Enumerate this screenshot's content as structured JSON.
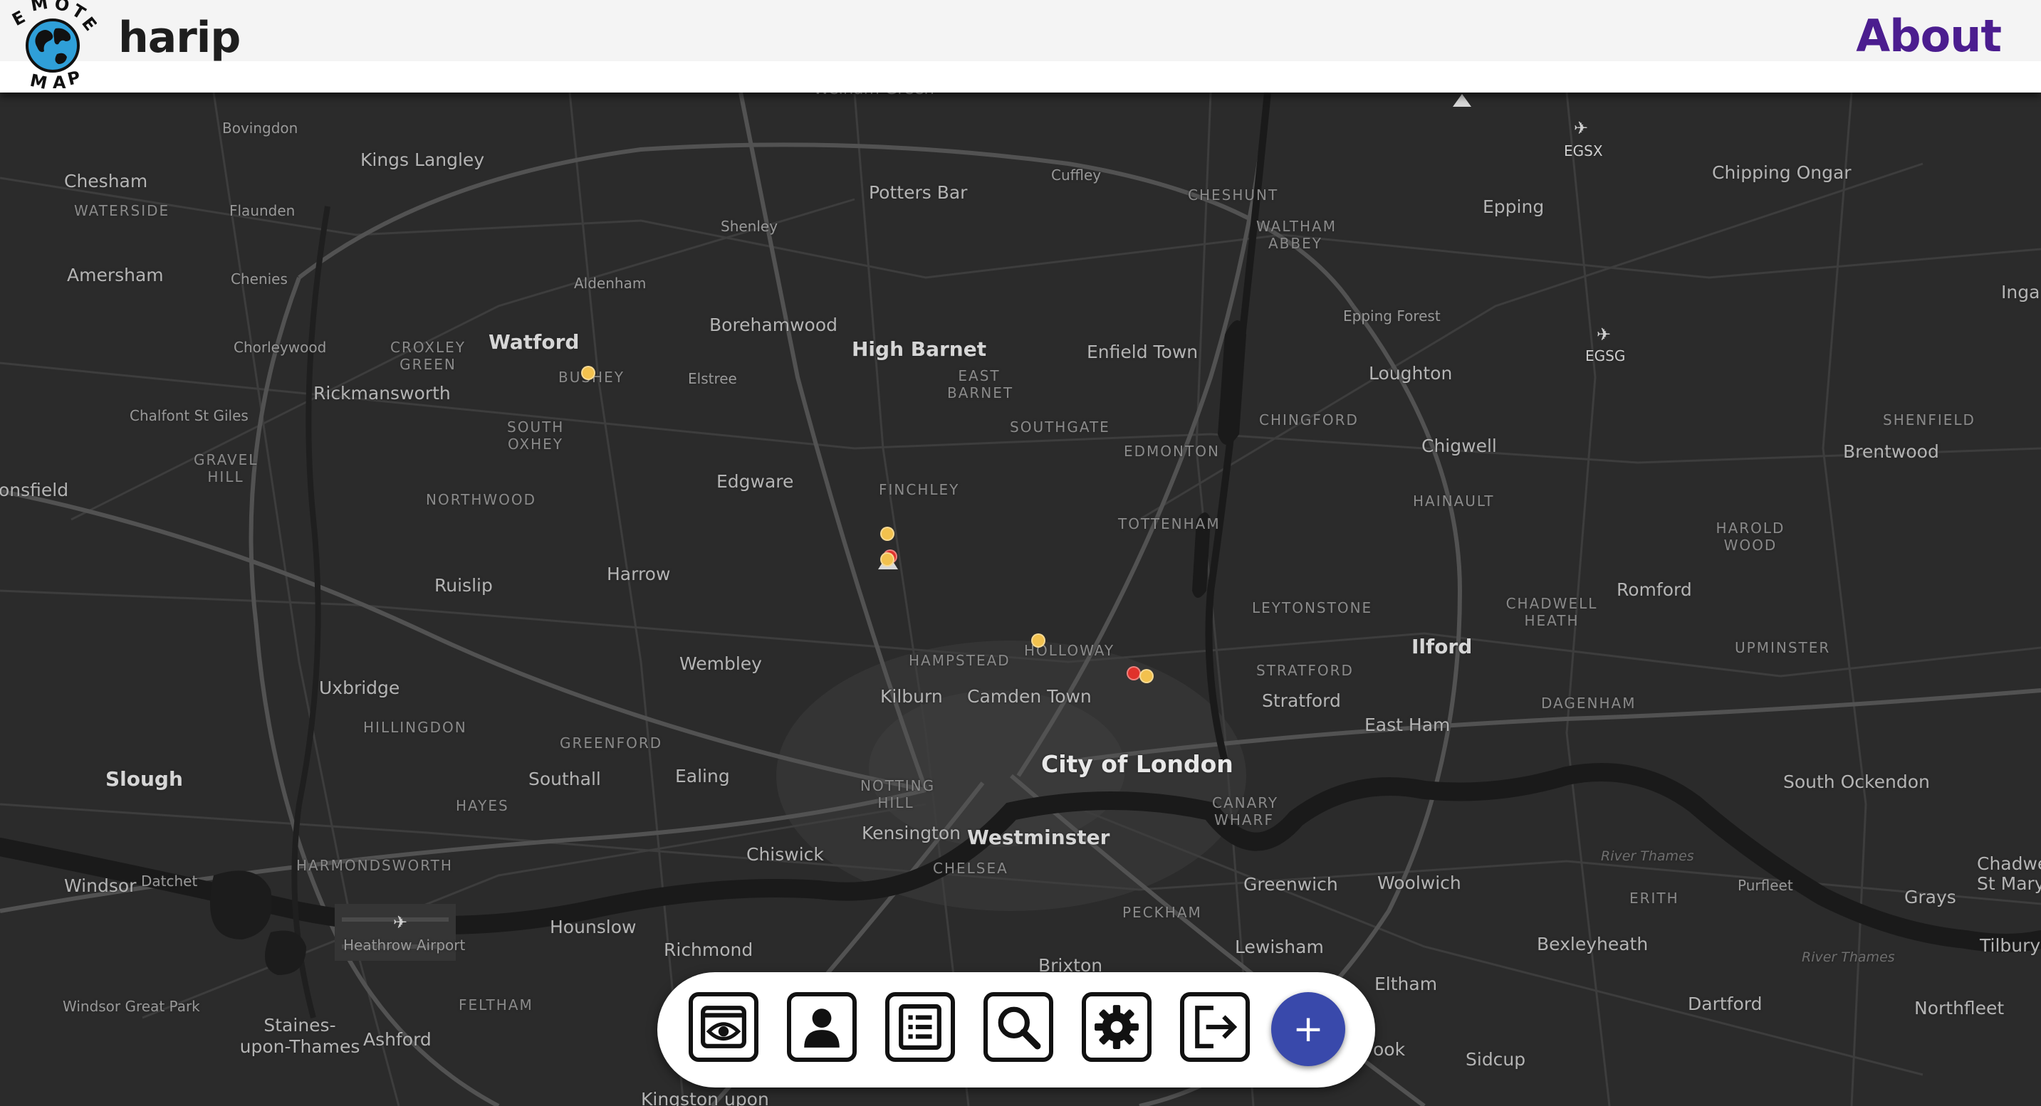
{
  "app": {
    "brand_name": "harip",
    "logo_text": "EMOTE MAP",
    "nav_about": "About"
  },
  "toolbar": {
    "buttons": [
      {
        "name": "view",
        "icon": "eye-icon"
      },
      {
        "name": "profile",
        "icon": "user-icon"
      },
      {
        "name": "list",
        "icon": "list-icon"
      },
      {
        "name": "search",
        "icon": "search-icon"
      },
      {
        "name": "settings",
        "icon": "gear-icon"
      },
      {
        "name": "logout",
        "icon": "logout-icon"
      }
    ],
    "add_label": "+",
    "add_color": "#3949ab"
  },
  "map": {
    "theme_color": "#2b2b2b",
    "labels": {
      "wenham_green": "Welham Green",
      "bovingdon": "Bovingdon",
      "kings_langley": "Kings Langley",
      "chesham": "Chesham",
      "waterside": "WATERSIDE",
      "flaunden": "Flaunden",
      "potters_bar": "Potters Bar",
      "cuffley": "Cuffley",
      "cheshunt": "CHESHUNT",
      "waltham_abbey": "WALTHAM ABBEY",
      "epping": "Epping",
      "chipping_ongar": "Chipping Ongar",
      "shenley": "Shenley",
      "amersham": "Amersham",
      "chenies": "Chenies",
      "aldenham": "Aldenham",
      "ingat": "Inga",
      "borehamwood": "Borehamwood",
      "epping_forest": "Epping Forest",
      "chorleywood": "Chorleywood",
      "croxley_green": "CROXLEY GREEN",
      "watford": "Watford",
      "high_barnet": "High Barnet",
      "enfield_town": "Enfield Town",
      "loughton": "Loughton",
      "bushey": "BUSHEY",
      "elstree": "Elstree",
      "east_barnet": "EAST BARNET",
      "rickmansworth": "Rickmansworth",
      "chalfont": "Chalfont St Giles",
      "south_oxhey": "SOUTH OXHEY",
      "southgate": "SOUTHGATE",
      "chingford": "CHINGFORD",
      "shenfield": "SHENFIELD",
      "chigwell": "Chigwell",
      "gravel_hill": "GRAVEL HILL",
      "edmonton": "EDMONTON",
      "brentwood": "Brentwood",
      "beaconsfield": "onsfield",
      "edgware": "Edgware",
      "finchley": "FINCHLEY",
      "northwood": "NORTHWOOD",
      "hainault": "HAINAULT",
      "tottenham": "TOTTENHAM",
      "harold_wood": "HAROLD WOOD",
      "harrow": "Harrow",
      "ruislip": "Ruislip",
      "chadwell_heath": "CHADWELL HEATH",
      "romford": "Romford",
      "leytonstone": "LEYTONSTONE",
      "ilford": "Ilford",
      "upminster": "UPMINSTER",
      "hampstead": "HAMPSTEAD",
      "holloway": "HOLLOWAY",
      "wembley": "Wembley",
      "stratford_d": "STRATFORD",
      "uxbridge": "Uxbridge",
      "kilburn": "Kilburn",
      "camden_town": "Camden Town",
      "stratford": "Stratford",
      "dagenham": "DAGENHAM",
      "east_ham": "East Ham",
      "hillingdon": "HILLINGDON",
      "greenford": "GREENFORD",
      "city_of_london": "City of London",
      "notting_hill": "NOTTING HILL",
      "slough": "Slough",
      "southall": "Southall",
      "ealing": "Ealing",
      "south_ockendon": "South Ockendon",
      "hayes": "HAYES",
      "canary_wharf": "CANARY WHARF",
      "kensington": "Kensington",
      "westminster": "Westminster",
      "chiswick": "Chiswick",
      "river_thames_1": "River Thames",
      "chadwell_st_mary": "Chadwe St Mary",
      "harmondsworth": "HARMONDSWORTH",
      "chelsea": "CHELSEA",
      "windsor": "Windsor",
      "datchet": "Datchet",
      "greenwich": "Greenwich",
      "woolwich": "Woolwich",
      "erith": "ERITH",
      "purfleet": "Purfleet",
      "grays": "Grays",
      "peckham": "PECKHAM",
      "heathrow": "Heathrow Airport",
      "hounslow": "Hounslow",
      "lewisham": "Lewisham",
      "bexleyheath": "Bexleyheath",
      "tilbury": "Tilbury",
      "richmond": "Richmond",
      "river_thames_2": "River Thames",
      "brixton": "Brixton",
      "eltham": "Eltham",
      "windsor_great_park": "Windsor Great Park",
      "feltham": "FELTHAM",
      "dartford": "Dartford",
      "northfleet": "Northfleet",
      "staines": "Staines-upon-Thames",
      "ashford": "Ashford",
      "bromley_ook": "ook",
      "sidcup": "Sidcup",
      "kingston": "Kingston upon",
      "egsx": "EGSX",
      "egsg": "EGSG"
    },
    "markers": [
      {
        "color": "yellow"
      },
      {
        "color": "yellow"
      },
      {
        "color": "red"
      },
      {
        "color": "yellow"
      },
      {
        "color": "yellow"
      },
      {
        "color": "red"
      },
      {
        "color": "yellow"
      }
    ]
  }
}
